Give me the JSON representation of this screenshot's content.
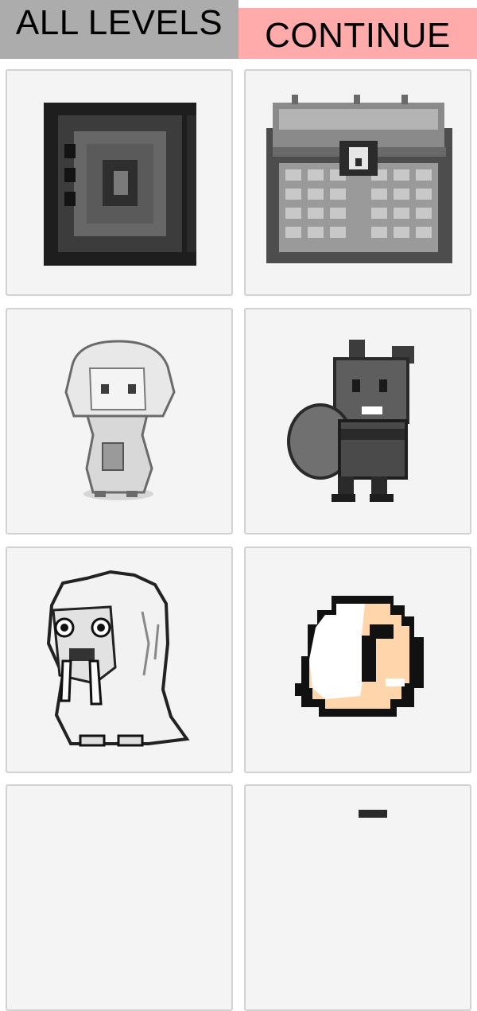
{
  "header": {
    "all_levels_label": "ALL LEVELS",
    "continue_label": "CONTINUE"
  },
  "levels": [
    {
      "icon": "safe-icon"
    },
    {
      "icon": "treasure-chest-icon"
    },
    {
      "icon": "hooded-girl-icon"
    },
    {
      "icon": "squirrel-thief-icon"
    },
    {
      "icon": "walrus-yeti-icon"
    },
    {
      "icon": "egg-creature-icon"
    },
    {
      "icon": "level-icon"
    },
    {
      "icon": "level-icon"
    }
  ],
  "colors": {
    "all_levels_bg": "#acacac",
    "continue_bg": "#ffabab",
    "card_bg": "#f4f4f4",
    "card_border": "#d2d2d2",
    "egg_accent": "#ffd6ac"
  }
}
